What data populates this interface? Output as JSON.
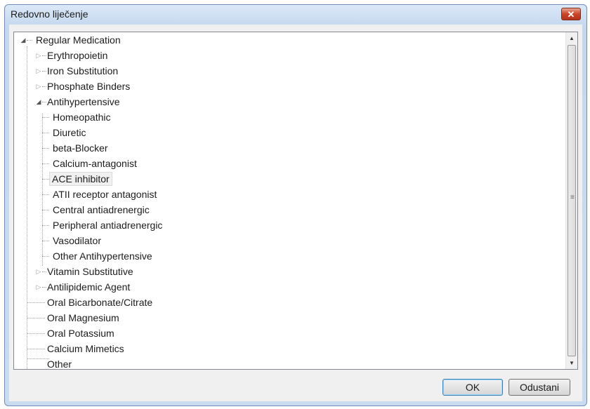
{
  "window": {
    "title": "Redovno liječenje"
  },
  "tree": {
    "root": "Regular Medication",
    "items": [
      {
        "label": "Erythropoietin"
      },
      {
        "label": "Iron Substitution"
      },
      {
        "label": "Phosphate Binders"
      },
      {
        "label": "Antihypertensive",
        "children": [
          "Homeopathic",
          "Diuretic",
          "beta-Blocker",
          "Calcium-antagonist",
          "ACE inhibitor",
          "ATII receptor antagonist",
          "Central antiadrenergic",
          "Peripheral antiadrenergic",
          "Vasodilator",
          "Other Antihypertensive"
        ]
      },
      {
        "label": "Vitamin Substitutive"
      },
      {
        "label": "Antilipidemic Agent"
      },
      {
        "label": "Oral Bicarbonate/Citrate"
      },
      {
        "label": "Oral Magnesium"
      },
      {
        "label": "Oral Potassium"
      },
      {
        "label": "Calcium Mimetics"
      },
      {
        "label": "Other"
      }
    ],
    "selected": "ACE inhibitor"
  },
  "buttons": {
    "ok": "OK",
    "cancel": "Odustani"
  },
  "colors": {
    "close_button": "#c9452a",
    "title_bar": "#c5d8ee",
    "selection": "#f0f0f0"
  }
}
